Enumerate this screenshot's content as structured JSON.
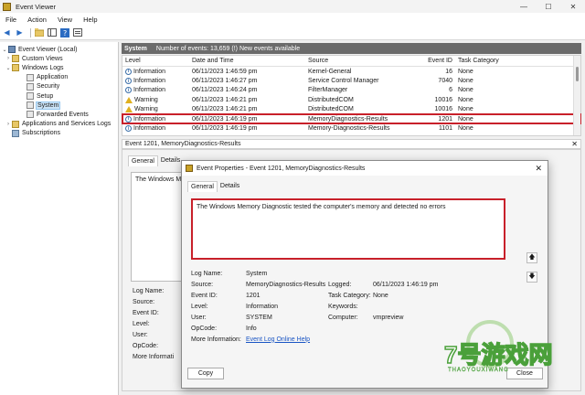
{
  "window": {
    "title": "Event Viewer",
    "controls": [
      "—",
      "☐",
      "✕"
    ]
  },
  "menu": [
    "File",
    "Action",
    "View",
    "Help"
  ],
  "tree": [
    {
      "label": "Event Viewer (Local)",
      "indent": 0,
      "expander": "⌄",
      "icon": "computer-log",
      "selected": false
    },
    {
      "label": "Custom Views",
      "indent": 1,
      "expander": "›",
      "icon": "folder",
      "selected": false
    },
    {
      "label": "Windows Logs",
      "indent": 1,
      "expander": "⌄",
      "icon": "folder",
      "selected": false
    },
    {
      "label": "Application",
      "indent": 2,
      "expander": "",
      "icon": "log",
      "selected": false
    },
    {
      "label": "Security",
      "indent": 2,
      "expander": "",
      "icon": "log",
      "selected": false
    },
    {
      "label": "Setup",
      "indent": 2,
      "expander": "",
      "icon": "log",
      "selected": false
    },
    {
      "label": "System",
      "indent": 2,
      "expander": "",
      "icon": "log",
      "selected": true
    },
    {
      "label": "Forwarded Events",
      "indent": 2,
      "expander": "",
      "icon": "log",
      "selected": false
    },
    {
      "label": "Applications and Services Logs",
      "indent": 1,
      "expander": "›",
      "icon": "folder",
      "selected": false
    },
    {
      "label": "Subscriptions",
      "indent": 1,
      "expander": "",
      "icon": "subscription",
      "selected": false
    }
  ],
  "header": {
    "log": "System",
    "count": "Number of events: 13,659 (!) New events available"
  },
  "list": {
    "columns": [
      "Level",
      "Date and Time",
      "Source",
      "Event ID",
      "Task Category"
    ],
    "rows": [
      {
        "level": "Information",
        "kind": "info",
        "date": "06/11/2023 1:46:59 pm",
        "source": "Kernel-General",
        "id": "16",
        "task": "None",
        "highlight": false
      },
      {
        "level": "Information",
        "kind": "info",
        "date": "06/11/2023 1:46:27 pm",
        "source": "Service Control Manager",
        "id": "7040",
        "task": "None",
        "highlight": false
      },
      {
        "level": "Information",
        "kind": "info",
        "date": "06/11/2023 1:46:24 pm",
        "source": "FilterManager",
        "id": "6",
        "task": "None",
        "highlight": false
      },
      {
        "level": "Warning",
        "kind": "warn",
        "date": "06/11/2023 1:46:21 pm",
        "source": "DistributedCOM",
        "id": "10016",
        "task": "None",
        "highlight": false
      },
      {
        "level": "Warning",
        "kind": "warn",
        "date": "06/11/2023 1:46:21 pm",
        "source": "DistributedCOM",
        "id": "10016",
        "task": "None",
        "highlight": false
      },
      {
        "level": "Information",
        "kind": "info",
        "date": "06/11/2023 1:46:19 pm",
        "source": "MemoryDiagnostics-Results",
        "id": "1201",
        "task": "None",
        "highlight": true
      },
      {
        "level": "Information",
        "kind": "info",
        "date": "06/11/2023 1:46:19 pm",
        "source": "Memory-Diagnostics-Results",
        "id": "1101",
        "task": "None",
        "highlight": false
      }
    ]
  },
  "detail": {
    "title": "Event 1201, MemoryDiagnostics-Results",
    "tabs": [
      "General",
      "Details"
    ],
    "preview": "The Windows M",
    "fields": [
      "Log Name:",
      "Source:",
      "Event ID:",
      "Level:",
      "User:",
      "OpCode:",
      "More Informati"
    ]
  },
  "dialog": {
    "title": "Event Properties - Event 1201, MemoryDiagnostics-Results",
    "tabs": [
      "General",
      "Details"
    ],
    "description": "The Windows Memory Diagnostic tested the computer's memory and detected no errors",
    "log_name_label": "Log Name:",
    "log_name": "System",
    "source_label": "Source:",
    "source": "MemoryDiagnostics-Results",
    "logged_label": "Logged:",
    "logged": "06/11/2023 1:46:19 pm",
    "event_id_label": "Event ID:",
    "event_id": "1201",
    "task_label": "Task Category:",
    "task": "None",
    "level_label": "Level:",
    "level": "Information",
    "keywords_label": "Keywords:",
    "keywords": "",
    "user_label": "User:",
    "user": "SYSTEM",
    "computer_label": "Computer:",
    "computer": "vmpreview",
    "opcode_label": "OpCode:",
    "opcode": "Info",
    "more_info_label": "More Information:",
    "more_info_link": "Event Log Online Help",
    "copy_label": "Copy",
    "close_label": "Close"
  },
  "watermark": {
    "brand": "7号游戏网",
    "sub": "THAOYOUXIWANG"
  }
}
